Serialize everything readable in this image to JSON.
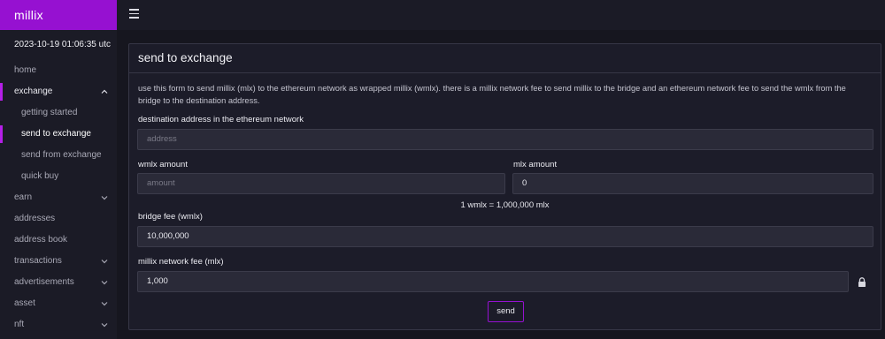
{
  "app": {
    "brand": "millix"
  },
  "sidebar": {
    "datetime": "2023-10-19 01:06:35 utc",
    "items": [
      {
        "label": "home"
      },
      {
        "label": "exchange"
      },
      {
        "label": "getting started"
      },
      {
        "label": "send to exchange"
      },
      {
        "label": "send from exchange"
      },
      {
        "label": "quick buy"
      },
      {
        "label": "earn"
      },
      {
        "label": "addresses"
      },
      {
        "label": "address book"
      },
      {
        "label": "transactions"
      },
      {
        "label": "advertisements"
      },
      {
        "label": "asset"
      },
      {
        "label": "nft"
      }
    ],
    "selected": "send to exchange"
  },
  "card": {
    "title": "send to exchange",
    "description": "use this form to send millix (mlx) to the ethereum network as wrapped millix (wmlx). there is a millix network fee to send millix to the bridge and an ethereum network fee to send the wmlx from the bridge to the destination address.",
    "destination": {
      "label": "destination address in the ethereum network",
      "placeholder": "address",
      "value": ""
    },
    "wmlx": {
      "label": "wmlx amount",
      "placeholder": "amount",
      "value": ""
    },
    "mlx": {
      "label": "mlx amount",
      "value": "0"
    },
    "conversion": "1 wmlx = 1,000,000 mlx",
    "bridge_fee": {
      "label": "bridge fee (wmlx)",
      "value": "10,000,000"
    },
    "network_fee": {
      "label": "millix network fee (mlx)",
      "value": "1,000"
    },
    "send_label": "send"
  },
  "colors": {
    "accent": "#9611d1",
    "marker": "#b51fe8",
    "background": "#16161f",
    "panel": "#1c1c29"
  },
  "icons": {
    "menu": "hamburger-icon",
    "expand": "chevron-icon",
    "lock": "lock-icon"
  }
}
